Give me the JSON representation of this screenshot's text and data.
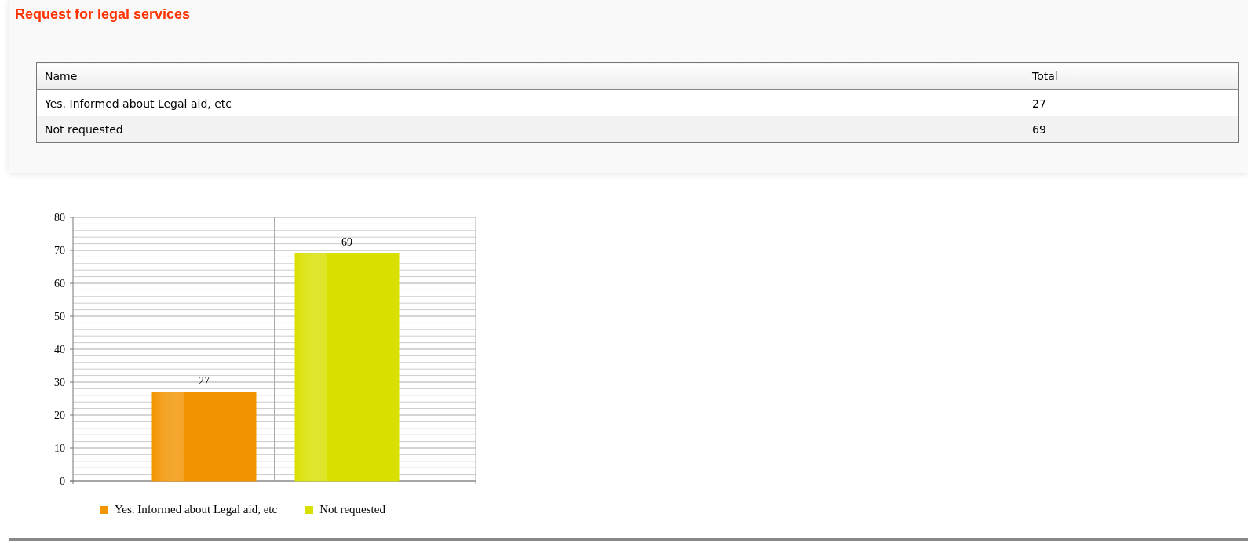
{
  "title": "Request for legal services",
  "table": {
    "columns": [
      "Name",
      "Total"
    ],
    "rows": [
      {
        "name": "Yes. Informed about Legal aid, etc",
        "total": "27"
      },
      {
        "name": "Not requested",
        "total": "69"
      }
    ]
  },
  "chart_data": {
    "type": "bar",
    "grid": true,
    "legend": true,
    "ylim": [
      0,
      80
    ],
    "yticks": [
      0,
      10,
      20,
      30,
      40,
      50,
      60,
      70,
      80
    ],
    "data_labels": true,
    "series": [
      {
        "name": "Yes. Informed about Legal aid, etc",
        "color": "#f29400",
        "values": [
          27
        ]
      },
      {
        "name": "Not requested",
        "color": "#d9e000",
        "values": [
          69
        ]
      }
    ]
  }
}
